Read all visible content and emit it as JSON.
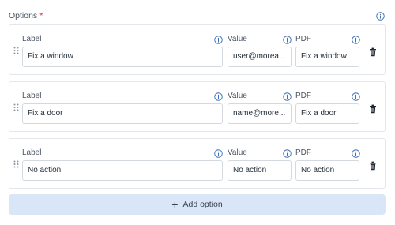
{
  "section": {
    "title": "Options",
    "required_marker": "*"
  },
  "columns": {
    "label": "Label",
    "value": "Value",
    "pdf": "PDF"
  },
  "options": [
    {
      "label": "Fix a window",
      "value": "user@morea...",
      "pdf": "Fix a window"
    },
    {
      "label": "Fix a door",
      "value": "name@more...",
      "pdf": "Fix a door"
    },
    {
      "label": "No action",
      "value": "No action",
      "pdf": "No action"
    }
  ],
  "add_button": {
    "icon": "+",
    "label": "Add option"
  },
  "icons": {
    "info": "info-icon",
    "drag": "drag-handle-icon",
    "delete": "trash-icon",
    "add": "plus-icon"
  },
  "colors": {
    "accent": "#3b6fb6",
    "required": "#dc2626",
    "add_button_bg": "#d9e6f8",
    "card_border": "#e3e7ec",
    "input_border": "#d4d9df"
  }
}
